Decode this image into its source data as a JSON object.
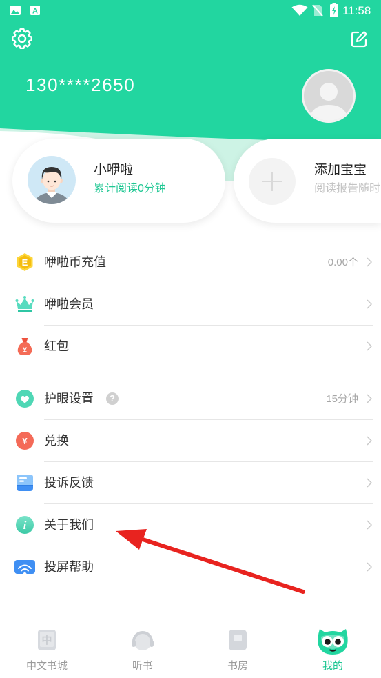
{
  "colors": {
    "brand_green": "#22d6a0",
    "accent_green": "#1fc793",
    "annotation_arrow": "#e8231f"
  },
  "status_bar": {
    "time": "11:58",
    "left_icons": [
      {
        "icon": "image-notification-icon"
      },
      {
        "icon": "a-notification-icon",
        "glyph": "A"
      }
    ],
    "right_icons": [
      "wifi-icon",
      "no-sim-icon",
      "battery-charging-icon"
    ]
  },
  "header": {
    "phone": "130****2650",
    "icons": [
      "gear-icon",
      "edit-icon",
      "user-avatar-icon"
    ]
  },
  "profiles": [
    {
      "name": "小咿啦",
      "subtitle": "累计阅读0分钟",
      "icon": "child-avatar-icon"
    },
    {
      "name": "添加宝宝",
      "subtitle": "阅读报告随时",
      "icon": "plus-icon"
    }
  ],
  "menu": {
    "section1": [
      {
        "label": "咿啦币充值",
        "value": "0.00个",
        "icon": "coin-icon",
        "glyph": "E"
      },
      {
        "label": "咿啦会员",
        "icon": "crown-icon"
      },
      {
        "label": "红包",
        "icon": "red-packet-icon",
        "glyph": "¥"
      }
    ],
    "section2": [
      {
        "label": "护眼设置",
        "value": "15分钟",
        "icon": "eye-care-icon",
        "help_glyph": "?"
      },
      {
        "label": "兑换",
        "icon": "exchange-icon",
        "glyph": "¥"
      },
      {
        "label": "投诉反馈",
        "icon": "feedback-icon"
      },
      {
        "label": "关于我们",
        "icon": "info-icon",
        "glyph": "i"
      },
      {
        "label": "投屏帮助",
        "icon": "screen-cast-icon"
      }
    ]
  },
  "tabs": [
    {
      "label": "中文书城",
      "icon": "bookstore-icon",
      "glyph": "中",
      "active": false
    },
    {
      "label": "听书",
      "icon": "headphones-icon",
      "active": false
    },
    {
      "label": "书房",
      "icon": "bookshelf-icon",
      "active": false
    },
    {
      "label": "我的",
      "icon": "owl-icon",
      "active": true
    }
  ]
}
